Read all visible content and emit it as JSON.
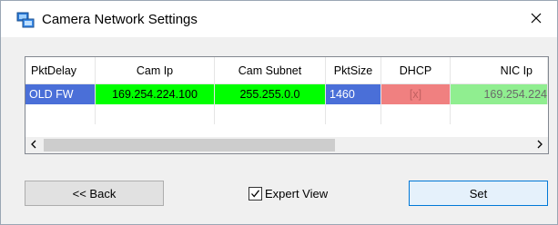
{
  "window": {
    "title": "Camera Network Settings",
    "icon": "network-app-icon",
    "close_icon": "close-icon"
  },
  "grid": {
    "columns": [
      "PktDelay",
      "Cam Ip",
      "Cam Subnet",
      "PktSize",
      "DHCP",
      "NIC Ip"
    ],
    "rows": [
      {
        "cells": [
          "OLD FW",
          "169.254.224.100",
          "255.255.0.0",
          "1460",
          "[x]",
          "169.254.224"
        ],
        "colors": [
          "#4a6fd8",
          "#00ff00",
          "#00ff00",
          "#4a6fd8",
          "#f08080",
          "#90ee90"
        ],
        "text_colors": [
          "#ffffff",
          "#000000",
          "#000000",
          "#ffffff",
          "#c06060",
          "#6a6a6a"
        ]
      }
    ],
    "scroll_left_icon": "chevron-left-icon",
    "scroll_right_icon": "chevron-right-icon"
  },
  "footer": {
    "back_label": "<< Back",
    "expert_view_label": "Expert View",
    "expert_view_checked": true,
    "set_label": "Set"
  }
}
